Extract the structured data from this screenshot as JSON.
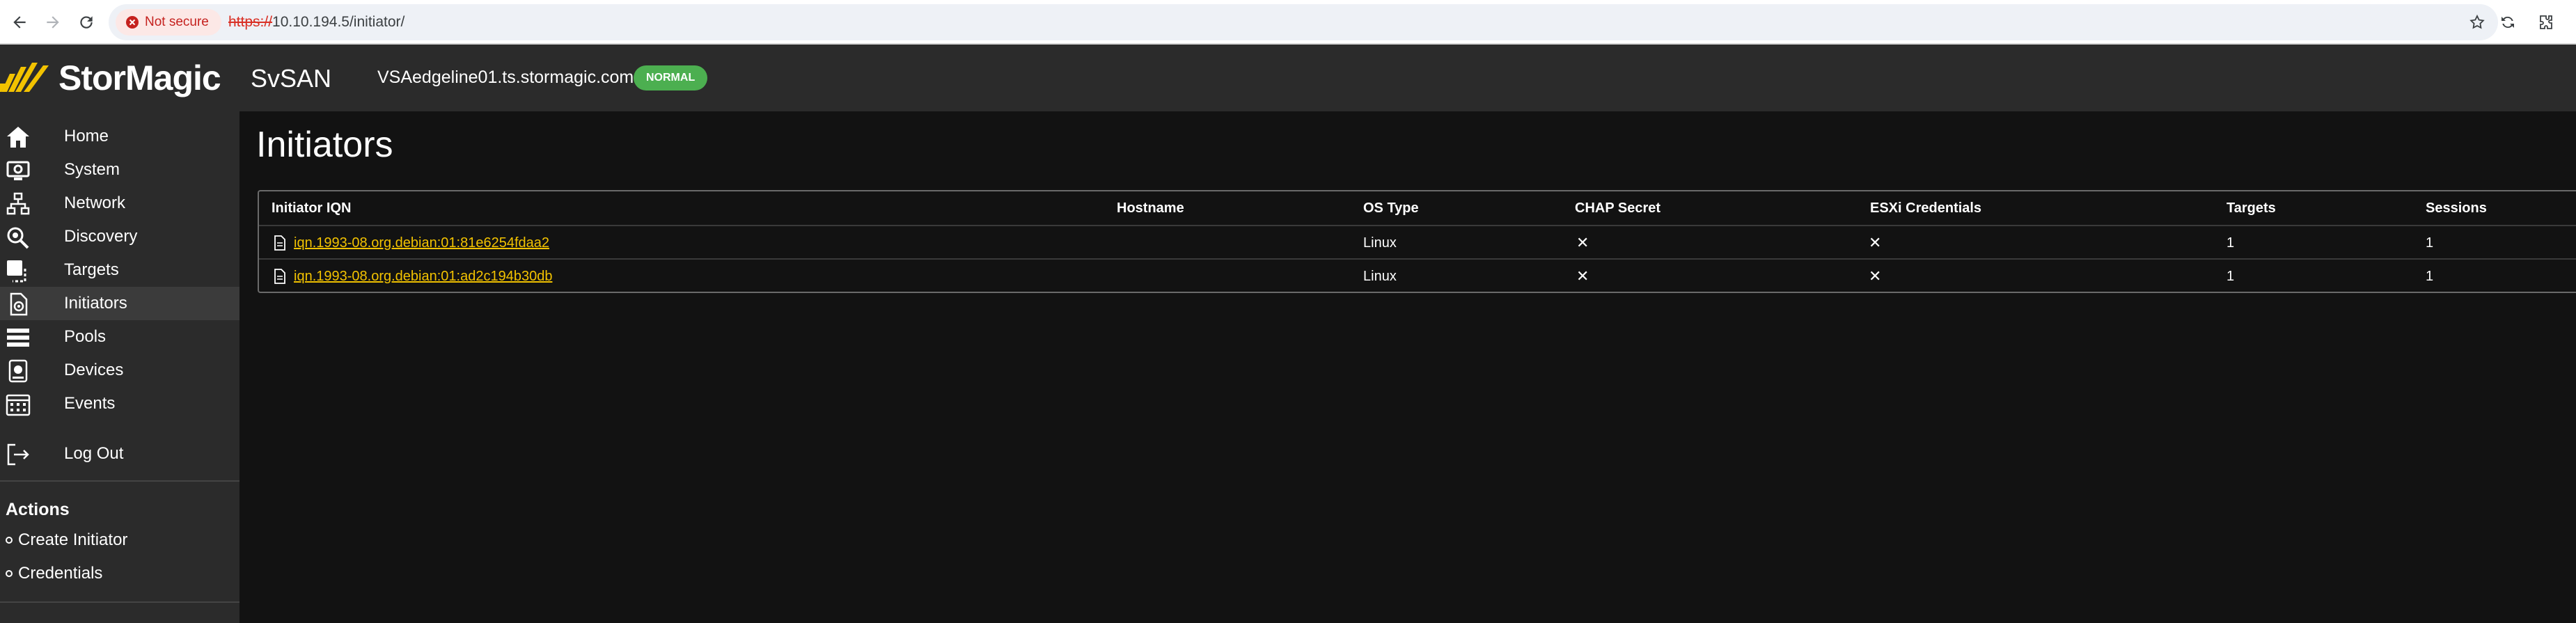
{
  "browser": {
    "security_label": "Not secure",
    "url_scheme": "https://",
    "url_rest": "10.10.194.5/initiator/"
  },
  "header": {
    "logo_text": "StorMagic",
    "product": "SvSAN",
    "hostname": "VSAedgeline01.ts.stormagic.com",
    "status": "NORMAL",
    "status_color": "#4caf50",
    "accent_color": "#f2c200"
  },
  "sidebar": {
    "items": [
      {
        "label": "Home",
        "icon": "home-icon"
      },
      {
        "label": "System",
        "icon": "system-icon"
      },
      {
        "label": "Network",
        "icon": "network-icon"
      },
      {
        "label": "Discovery",
        "icon": "discovery-icon"
      },
      {
        "label": "Targets",
        "icon": "targets-icon"
      },
      {
        "label": "Initiators",
        "icon": "initiators-icon"
      },
      {
        "label": "Pools",
        "icon": "pools-icon"
      },
      {
        "label": "Devices",
        "icon": "devices-icon"
      },
      {
        "label": "Events",
        "icon": "events-icon"
      },
      {
        "label": "Log Out",
        "icon": "logout-icon"
      }
    ],
    "active": "Initiators",
    "actions_title": "Actions",
    "actions": [
      {
        "label": "Create Initiator"
      },
      {
        "label": "Credentials"
      }
    ]
  },
  "main": {
    "title": "Initiators",
    "table": {
      "columns": [
        "Initiator IQN",
        "Hostname",
        "OS Type",
        "CHAP Secret",
        "ESXi Credentials",
        "Targets",
        "Sessions"
      ],
      "rows": [
        {
          "iqn": "iqn.1993-08.org.debian:01:81e6254fdaa2",
          "hostname": "",
          "os": "Linux",
          "chap": "✕",
          "esxi": "✕",
          "targets": "1",
          "sessions": "1"
        },
        {
          "iqn": "iqn.1993-08.org.debian:01:ad2c194b30db",
          "hostname": "",
          "os": "Linux",
          "chap": "✕",
          "esxi": "✕",
          "targets": "1",
          "sessions": "1"
        }
      ]
    }
  }
}
